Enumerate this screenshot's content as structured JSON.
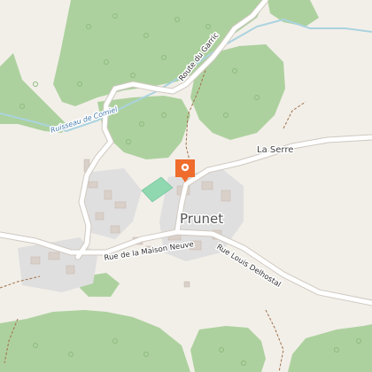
{
  "map": {
    "labels": {
      "stream": "Ruisseau de Comiel",
      "road_north": "Route du Garric",
      "hamlet": "La Serre",
      "village": "Prunet",
      "street_west": "Rue de la Maison Neuve",
      "street_southeast": "Rue Louis Delhostal"
    },
    "marker": {
      "icon": "location-pin-icon",
      "color": "#ef6c2c"
    },
    "colors": {
      "background": "#f2efe9",
      "forest": "#add19e",
      "water": "#aad3df",
      "road": "#ffffff",
      "building": "#d9d0c9",
      "residential": "#e0dfdf",
      "park": "#8fd8b0",
      "track": "#a0714a"
    }
  }
}
